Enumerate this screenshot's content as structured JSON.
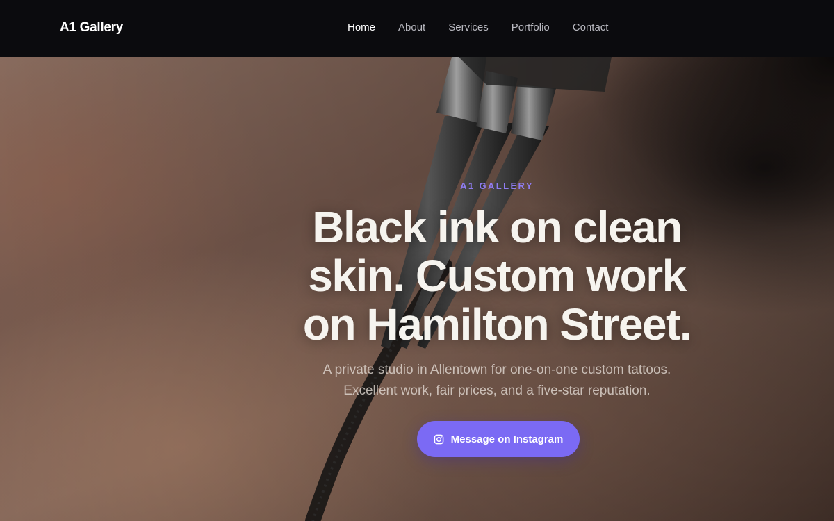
{
  "nav": {
    "brand": "A1 Gallery",
    "links": [
      {
        "label": "Home",
        "active": true
      },
      {
        "label": "About",
        "active": false
      },
      {
        "label": "Services",
        "active": false
      },
      {
        "label": "Portfolio",
        "active": false
      },
      {
        "label": "Contact",
        "active": false
      }
    ]
  },
  "hero": {
    "eyebrow": "A1 GALLERY",
    "headline_lines": [
      "Black ink on clean",
      "skin. Custom work",
      "on Hamilton Street."
    ],
    "subtext_lines": [
      "A private studio in Allentown for one-on-one custom tattoos.",
      "Excellent work, fair prices, and a five-star reputation."
    ],
    "cta": {
      "label": "Message on Instagram",
      "icon": "instagram-icon"
    }
  },
  "colors": {
    "accent": "#7b6af4",
    "eyebrow": "#8f7cf0",
    "nav_bg": "#0b0b0e",
    "headline": "#f6f4ef"
  }
}
